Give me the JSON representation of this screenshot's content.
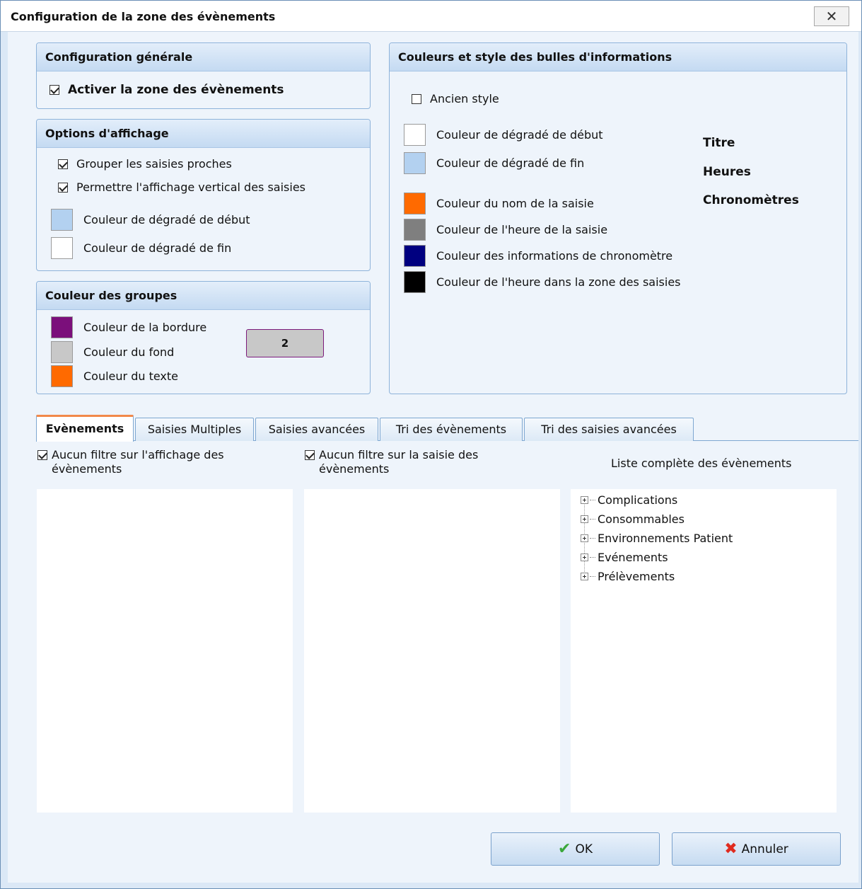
{
  "window": {
    "title": "Configuration de la zone des évènements",
    "close_glyph": "✕"
  },
  "general": {
    "header": "Configuration générale",
    "activate_label": "Activer la zone des évènements",
    "activate_checked": true
  },
  "display_options": {
    "header": "Options d'affichage",
    "group_label": "Grouper les saisies proches",
    "vertical_label": "Permettre l'affichage vertical des saisies",
    "gradient_start_label": "Couleur de dégradé de début",
    "gradient_start_color": "#b3d1f0",
    "gradient_end_label": "Couleur de dégradé de fin",
    "gradient_end_color": "#ffffff"
  },
  "group_colors": {
    "header": "Couleur des groupes",
    "border_label": "Couleur de la bordure",
    "border_color": "#7b0f7b",
    "background_label": "Couleur du fond",
    "background_color": "#c8c8c8",
    "text_label": "Couleur du texte",
    "text_color": "#ff6a00",
    "preview_value": "2"
  },
  "bubbles": {
    "header": "Couleurs et style des bulles d'informations",
    "old_style_label": "Ancien style",
    "old_style_checked": false,
    "grad_start_label": "Couleur de dégradé de début",
    "grad_start_color": "#ffffff",
    "grad_end_label": "Couleur de dégradé de fin",
    "grad_end_color": "#b3d1f0",
    "name_label": "Couleur du nom de la saisie",
    "name_color": "#ff6a00",
    "time_label": "Couleur de l'heure de la saisie",
    "time_color": "#7f7f7f",
    "chrono_label": "Couleur des informations de chronomètre",
    "chrono_color": "#000080",
    "zone_time_label": "Couleur de l'heure dans la zone des saisies",
    "zone_time_color": "#000000",
    "legend": {
      "title": "Titre",
      "hours": "Heures",
      "chrono": "Chronomètres"
    }
  },
  "tabs": [
    {
      "label": "Evènements",
      "active": true
    },
    {
      "label": "Saisies Multiples",
      "active": false
    },
    {
      "label": "Saisies avancées",
      "active": false
    },
    {
      "label": "Tri des évènements",
      "active": false
    },
    {
      "label": "Tri des saisies avancées",
      "active": false
    }
  ],
  "events_tab": {
    "filter_display_label": "Aucun filtre sur l'affichage des évènements",
    "filter_entry_label": "Aucun filtre sur la saisie des évènements",
    "full_list_label": "Liste complète des évènements",
    "tree_items": [
      "Complications",
      "Consommables",
      "Environnements Patient",
      "Evénements",
      "Prélèvements"
    ]
  },
  "buttons": {
    "ok_label": "OK",
    "cancel_label": "Annuler"
  }
}
